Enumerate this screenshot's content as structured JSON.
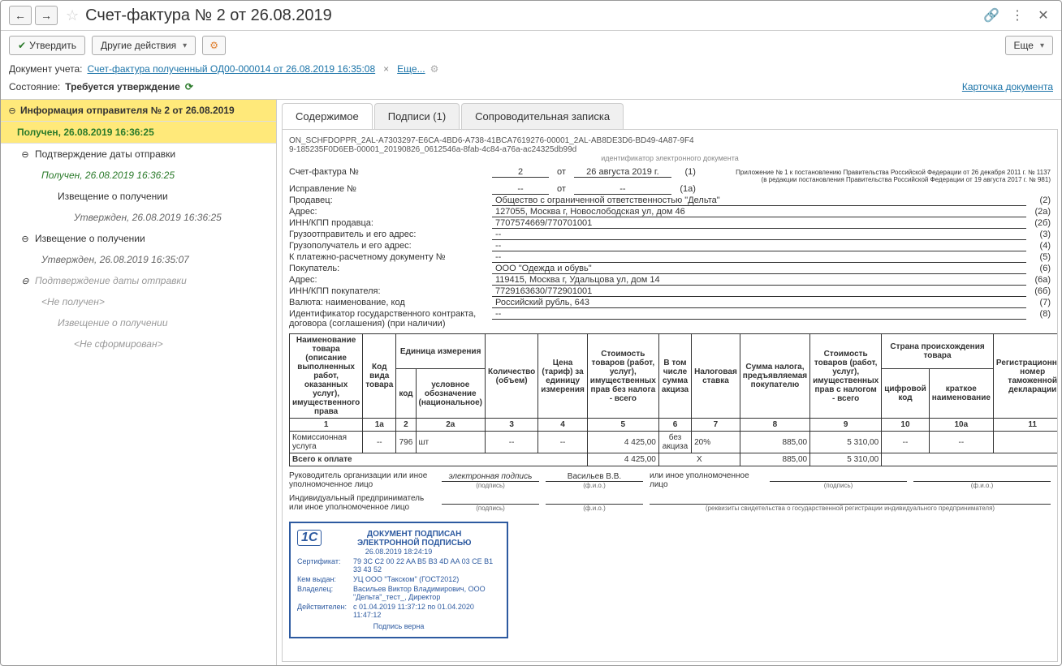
{
  "header": {
    "title": "Счет-фактура № 2 от 26.08.2019"
  },
  "toolbar": {
    "approve": "Утвердить",
    "other": "Другие действия",
    "more": "Еще"
  },
  "infobar": {
    "label": "Документ учета:",
    "doc_link": "Счет-фактура полученный ОД00-000014 от 26.08.2019 16:35:08",
    "more_link": "Еще..."
  },
  "status": {
    "label": "Состояние:",
    "value": "Требуется утверждение",
    "card_link": "Карточка документа"
  },
  "sidebar": {
    "root_title": "Информация отправителя № 2 от 26.08.2019",
    "root_status": "Получен, 26.08.2019 16:36:25",
    "item1": "Подтверждение даты отправки",
    "item1_status": "Получен, 26.08.2019 16:36:25",
    "item1a": "Извещение о получении",
    "item1a_status": "Утвержден, 26.08.2019 16:36:25",
    "item2": "Извещение о получении",
    "item2_status": "Утвержден, 26.08.2019 16:35:07",
    "item3": "Подтверждение даты отправки",
    "item3_status": "<Не получен>",
    "item3a": "Извещение о получении",
    "item3a_status": "<Не сформирован>"
  },
  "tabs": {
    "t1": "Содержимое",
    "t2": "Подписи (1)",
    "t3": "Сопроводительная записка"
  },
  "doc": {
    "id1": "ON_SCHFDOPPR_2AL-A7303297-E6CA-4BD6-A738-41BCA7619276-00001_2AL-AB8DE3D6-BD49-4A87-9F4",
    "id2": "9-185235F0D6EB-00001_20190826_0612546a-8fab-4c84-a76a-ac24325db99d",
    "id_caption": "идентификатор электронного документа",
    "appx1": "Приложение № 1 к постановлению Правительства Российской Федерации от 26 декабря 2011 г. № 1137",
    "appx2": "(в редакции постановления Правительства Российской Федерации от 19 августа 2017 г. № 981)",
    "rows": {
      "inv_no_lbl": "Счет-фактура №",
      "inv_no": "2",
      "from_lbl": "от",
      "inv_date": "26 августа 2019 г.",
      "n1": "(1)",
      "corr_lbl": "Исправление №",
      "corr_no": "--",
      "corr_date": "--",
      "n1a": "(1а)",
      "seller_lbl": "Продавец:",
      "seller": "Общество с ограниченной ответственностью \"Дельта\"",
      "n2": "(2)",
      "addr_lbl": "Адрес:",
      "addr": "127055, Москва г, Новослободская ул, дом 46",
      "n2a": "(2а)",
      "inn_s_lbl": "ИНН/КПП продавца:",
      "inn_s": "7707574669/770701001",
      "n2b": "(2б)",
      "ship_lbl": "Грузоотправитель и его адрес:",
      "ship": "--",
      "n3": "(3)",
      "cons_lbl": "Грузополучатель и его адрес:",
      "cons": "--",
      "n4": "(4)",
      "pay_lbl": "К платежно-расчетному документу №",
      "pay": "--",
      "n5": "(5)",
      "buyer_lbl": "Покупатель:",
      "buyer": "ООО \"Одежда и обувь\"",
      "n6": "(6)",
      "baddr_lbl": "Адрес:",
      "baddr": "119415, Москва г, Удальцова ул, дом 14",
      "n6a": "(6а)",
      "binn_lbl": "ИНН/КПП покупателя:",
      "binn": "7729163630/772901001",
      "n6b": "(6б)",
      "cur_lbl": "Валюта: наименование, код",
      "cur": "Российский рубль, 643",
      "n7": "(7)",
      "gc_lbl": "Идентификатор государственного контракта, договора (соглашения) (при наличии)",
      "gc": "--",
      "n8": "(8)"
    },
    "thead": {
      "c1": "Наименование товара (описание выполненных работ, оказанных услуг), имущественного права",
      "c1a": "Код вида товара",
      "c2g": "Единица измерения",
      "c2": "код",
      "c2a": "условное обозначение (национальное)",
      "c3": "Количество (объем)",
      "c4": "Цена (тариф) за единицу измерения",
      "c5": "Стоимость товаров (работ, услуг), имущественных прав без налога - всего",
      "c6": "В том числе сумма акциза",
      "c7": "Налоговая ставка",
      "c8": "Сумма налога, предъявляемая покупателю",
      "c9": "Стоимость товаров (работ, услуг), имущественных прав с налогом - всего",
      "c10g": "Страна происхождения товара",
      "c10": "цифровой код",
      "c10a": "краткое наименование",
      "c11": "Регистрационный номер таможенной декларации",
      "n1": "1",
      "n1a": "1а",
      "n2": "2",
      "n2a": "2а",
      "n3": "3",
      "n4": "4",
      "n5": "5",
      "n6": "6",
      "n7": "7",
      "n8": "8",
      "n9": "9",
      "n10": "10",
      "n10a": "10а",
      "n11": "11"
    },
    "row": {
      "name": "Комиссионная услуга",
      "c1a": "--",
      "code": "796",
      "unit": "шт",
      "qty": "--",
      "price": "--",
      "sum_wo": "4 425,00",
      "excise": "без акциза",
      "rate": "20%",
      "tax": "885,00",
      "sum_w": "5 310,00",
      "cc": "--",
      "cn": "--",
      "td": ""
    },
    "total": {
      "lbl": "Всего к оплате",
      "sum_wo": "4 425,00",
      "x": "X",
      "tax": "885,00",
      "sum_w": "5 310,00"
    },
    "sig": {
      "head_lbl": "Руководитель организации или иное уполномоченное лицо",
      "esig": "электронная подпись",
      "name": "Васильев В.В.",
      "or": "или иное уполномоченное лицо",
      "ip_lbl": "Индивидуальный предприниматель или иное уполномоченное лицо",
      "cap_sig": "(подпись)",
      "cap_fio": "(ф.и.о.)",
      "cap_req": "(реквизиты свидетельства о государственной регистрации индивидуального предпринимателя)"
    },
    "stamp": {
      "title1": "ДОКУМЕНТ ПОДПИСАН",
      "title2": "ЭЛЕКТРОННОЙ ПОДПИСЬЮ",
      "date": "26.08.2019 18:24:19",
      "cert_k": "Сертификат:",
      "cert_v": "79 3C C2 00 22 AA B5 B3 4D AA 03 CE B1 33 43 52",
      "issued_k": "Кем выдан:",
      "issued_v": "УЦ ООО \"Такском\" (ГОСТ2012)",
      "owner_k": "Владелец:",
      "owner_v": "Васильев Виктор Владимирович, ООО \"Дельта\"_тест_, Директор",
      "valid_k": "Действителен:",
      "valid_v": "с 01.04.2019 11:37:12 по 01.04.2020 11:47:12",
      "ok": "Подпись верна"
    }
  }
}
